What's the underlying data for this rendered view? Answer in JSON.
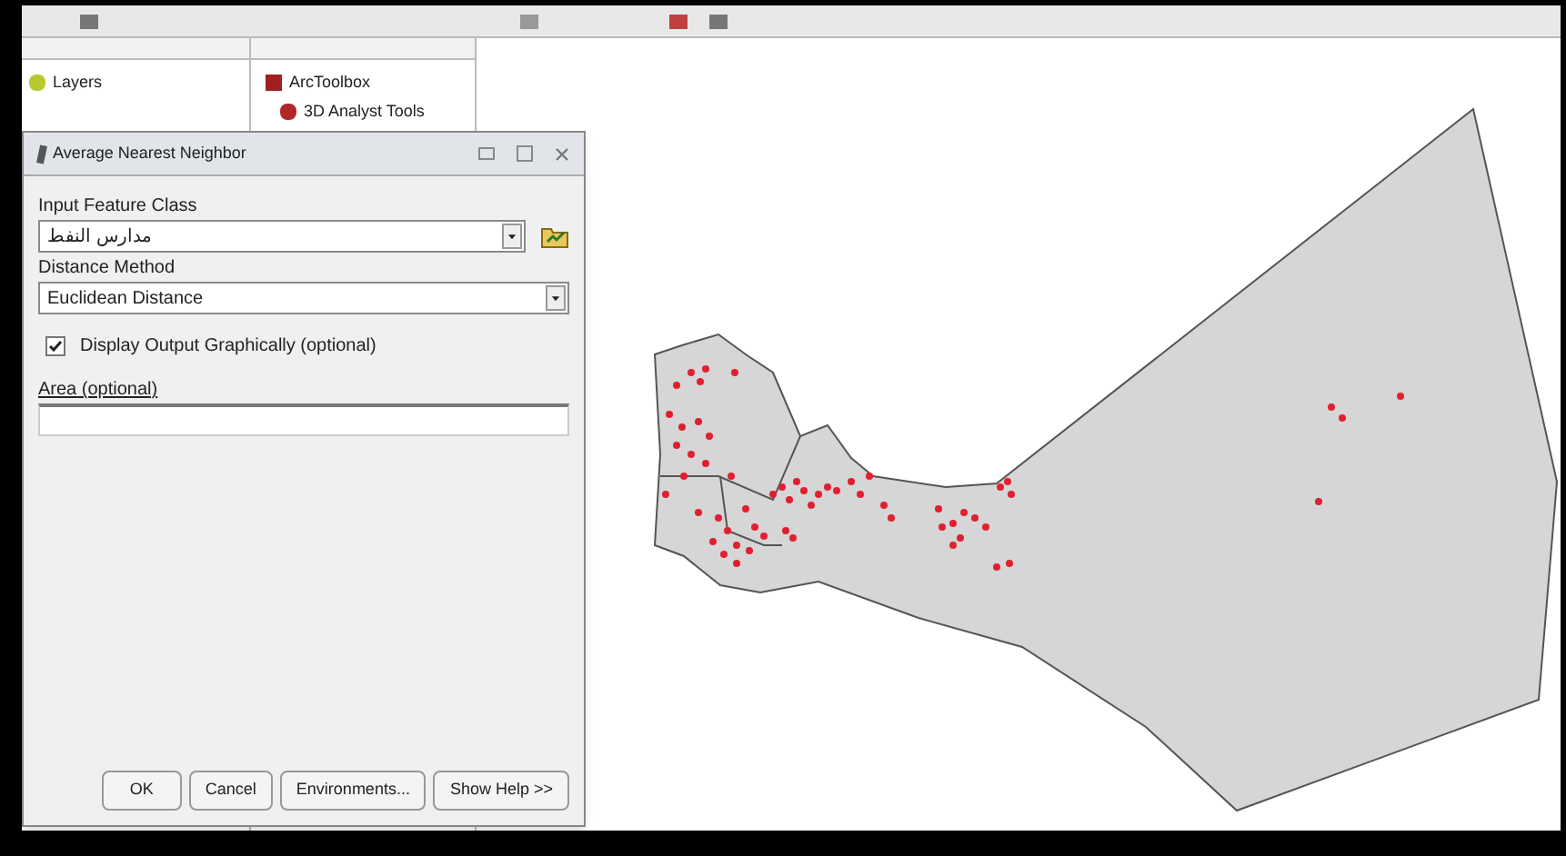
{
  "toc": {
    "title": "Layers"
  },
  "toolbox": {
    "title": "ArcToolbox",
    "items": [
      "3D Analyst Tools"
    ]
  },
  "dialog": {
    "title": "Average Nearest Neighbor",
    "fields": [
      {
        "kind": "dropdown",
        "label": "Input Feature Class",
        "value": "مدارس النفط",
        "browse": true
      },
      {
        "kind": "dropdown",
        "label": "Distance Method",
        "value": "Euclidean Distance"
      },
      {
        "kind": "checkbox",
        "label": "Display Output Graphically (optional)",
        "checked": true
      },
      {
        "kind": "text",
        "label": "Area (optional)"
      }
    ],
    "buttons": [
      "OK",
      "Cancel",
      "Environments...",
      "Show Help >>"
    ]
  }
}
